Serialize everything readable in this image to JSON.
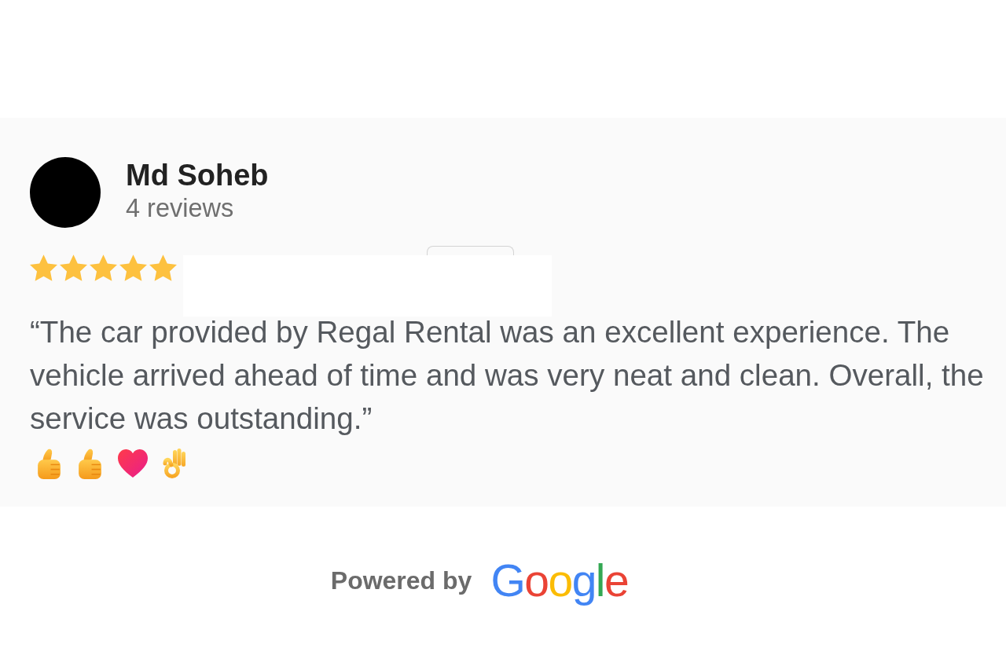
{
  "review": {
    "author": "Md Soheb",
    "review_count": "4 reviews",
    "stars": 5,
    "text": "“The car provided by Regal Rental was an excellent experience. The vehicle arrived ahead of time and was very neat and clean. Overall, the service was outstanding.”",
    "reactions": [
      {
        "kind": "thumbs-up"
      },
      {
        "kind": "thumbs-up"
      },
      {
        "kind": "heart"
      },
      {
        "kind": "ok-hand"
      }
    ]
  },
  "footer": {
    "label": "Powered by",
    "logo": "Google"
  }
}
